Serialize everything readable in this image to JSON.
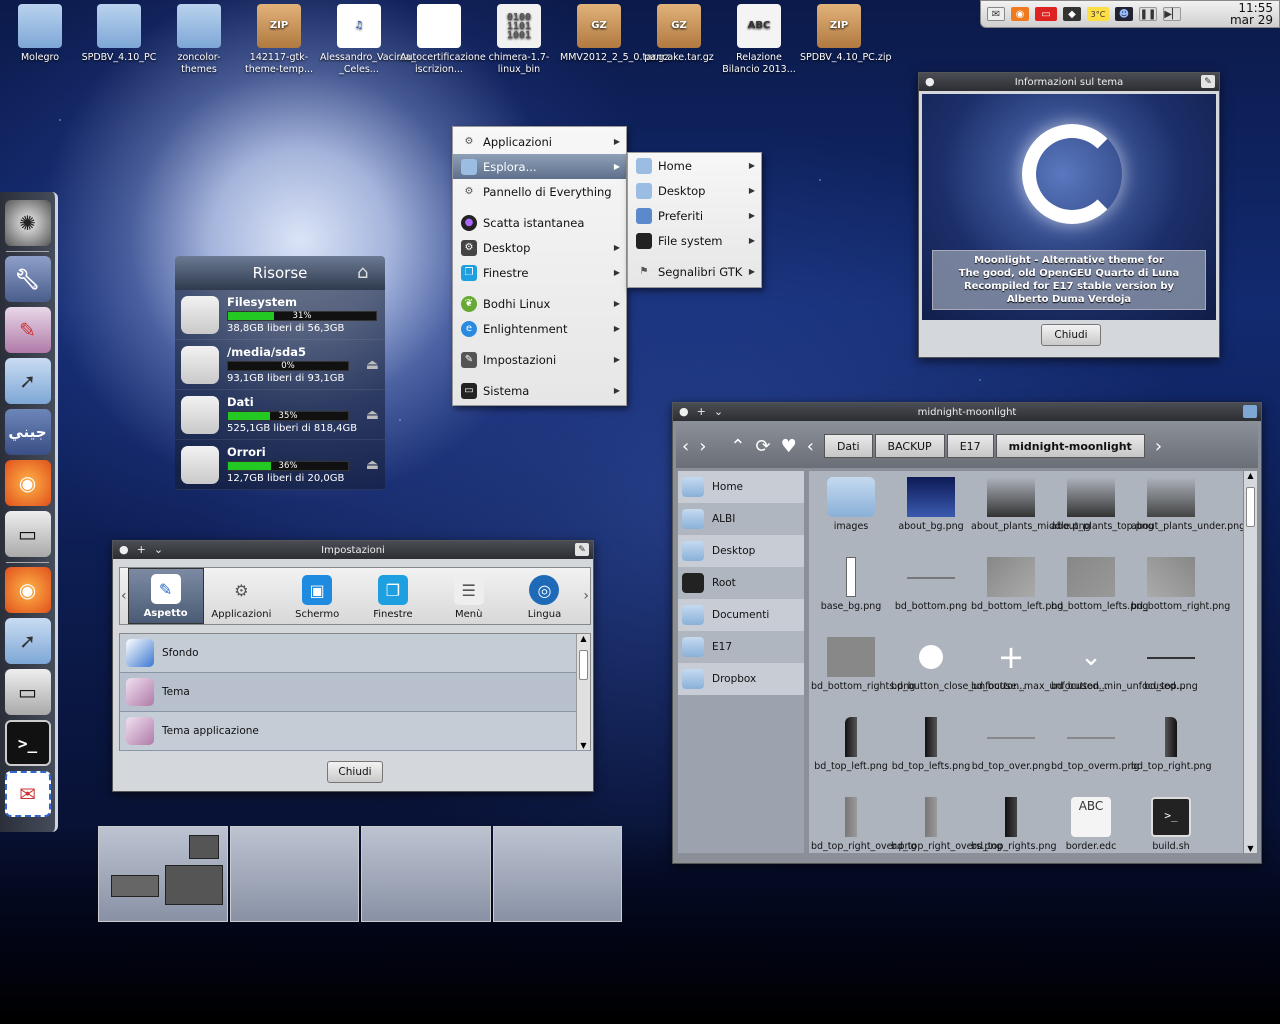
{
  "desktop_icons": [
    {
      "label": "Molegro",
      "kind": "folder"
    },
    {
      "label": "SPDBV_4.10_PC",
      "kind": "folder"
    },
    {
      "label": "zoncolor-themes",
      "kind": "folder"
    },
    {
      "label": "142117-gtk-theme-temp...",
      "kind": "zip",
      "badge": "ZIP"
    },
    {
      "label": "Alessandro_Vacirca_-_Celes...",
      "kind": "mp3",
      "badge": "♫"
    },
    {
      "label": "Autocertificazione iscrizion...",
      "kind": "window"
    },
    {
      "label": "chimera-1.7-linux_bin",
      "kind": "binary",
      "badge": "0100 1101 1001"
    },
    {
      "label": "MMV2012_2_5_0.tar.gz",
      "kind": "zip",
      "badge": "GZ"
    },
    {
      "label": "pancake.tar.gz",
      "kind": "zip",
      "badge": "GZ"
    },
    {
      "label": "Relazione Bilancio 2013...",
      "kind": "text",
      "badge": "ABC"
    },
    {
      "label": "SPDBV_4.10_PC.zip",
      "kind": "zip",
      "badge": "ZIP"
    }
  ],
  "tray": {
    "icons": [
      "mail-icon",
      "rss-icon",
      "battery-icon",
      "dropbox-icon",
      "weather-icon",
      "user-icon",
      "pause-icon",
      "next-icon"
    ],
    "weather_temp": "3°C",
    "time": "11:55",
    "date": "mar 29"
  },
  "risorse": {
    "title": "Risorse",
    "disks": [
      {
        "name": "Filesystem",
        "percent": 31,
        "percent_label": "31%",
        "free": "38,8GB liberi di 56,3GB",
        "eject": false
      },
      {
        "name": "/media/sda5",
        "percent": 0,
        "percent_label": "0%",
        "free": "93,1GB liberi di 93,1GB",
        "eject": true
      },
      {
        "name": "Dati",
        "percent": 35,
        "percent_label": "35%",
        "free": "525,1GB liberi di 818,4GB",
        "eject": true
      },
      {
        "name": "Orrori",
        "percent": 36,
        "percent_label": "36%",
        "free": "12,7GB liberi di 20,0GB",
        "eject": true
      }
    ]
  },
  "main_menu": {
    "items": [
      {
        "label": "Applicazioni",
        "icon": "gear-icon",
        "submenu": true
      },
      {
        "label": "Esplora...",
        "icon": "folder-icon",
        "submenu": true,
        "active": true
      },
      {
        "label": "Pannello di Everything",
        "icon": "gears-icon",
        "submenu": false
      },
      {
        "label": "Scatta istantanea",
        "icon": "camera-icon",
        "submenu": false
      },
      {
        "label": "Desktop",
        "icon": "gear-icon",
        "submenu": true
      },
      {
        "label": "Finestre",
        "icon": "windows-icon",
        "submenu": true
      },
      {
        "label": "Bodhi Linux",
        "icon": "leaf-icon",
        "submenu": true
      },
      {
        "label": "Enlightenment",
        "icon": "e-icon",
        "submenu": true
      },
      {
        "label": "Impostazioni",
        "icon": "wrench-icon",
        "submenu": true
      },
      {
        "label": "Sistema",
        "icon": "monitor-icon",
        "submenu": true
      }
    ]
  },
  "sub_menu": {
    "items": [
      {
        "label": "Home",
        "submenu": true
      },
      {
        "label": "Desktop",
        "submenu": true
      },
      {
        "label": "Preferiti",
        "submenu": true
      },
      {
        "label": "File system",
        "submenu": true
      },
      {
        "label": "Segnalibri GTK",
        "submenu": true
      }
    ]
  },
  "theme_window": {
    "title": "Informazioni sul tema",
    "description": [
      "Moonlight - Alternative theme for",
      "The good, old OpenGEU Quarto di Luna",
      "Recompiled for E17 stable version by",
      "Alberto Duma Verdoja"
    ],
    "close_label": "Chiudi"
  },
  "settings_window": {
    "title": "Impostazioni",
    "tabs": [
      {
        "label": "Aspetto",
        "selected": true
      },
      {
        "label": "Applicazioni",
        "selected": false
      },
      {
        "label": "Schermo",
        "selected": false
      },
      {
        "label": "Finestre",
        "selected": false
      },
      {
        "label": "Menù",
        "selected": false
      },
      {
        "label": "Lingua",
        "selected": false
      }
    ],
    "list": [
      "Sfondo",
      "Tema",
      "Tema applicazione"
    ],
    "close_label": "Chiudi"
  },
  "file_manager": {
    "title": "midnight-moonlight",
    "breadcrumbs": [
      "Dati",
      "BACKUP",
      "E17",
      "midnight-moonlight"
    ],
    "sidebar": [
      "Home",
      "ALBI",
      "Desktop",
      "Root",
      "Documenti",
      "E17",
      "Dropbox"
    ],
    "files": [
      "images",
      "about_bg.png",
      "about_plants_middle.png",
      "about_plants_top.png",
      "about_plants_under.png",
      "base_bg.png",
      "bd_bottom.png",
      "bd_bottom_left.png",
      "bd_bottom_lefts.png",
      "bd_bottom_right.png",
      "bd_bottom_rights.png",
      "bd_button_close_unfocuse...",
      "bd_button_max_unfocused...",
      "bd_button_min_unfocused...",
      "bd_top.png",
      "bd_top_left.png",
      "bd_top_lefts.png",
      "bd_top_over.png",
      "bd_top_overm.png",
      "bd_top_right.png",
      "bd_top_right_over.png",
      "bd_top_right_overs.png",
      "bd_top_rights.png",
      "border.edc",
      "build.sh"
    ]
  },
  "colors": {
    "accent": "#5d6f8c",
    "progress": "#23c823"
  }
}
